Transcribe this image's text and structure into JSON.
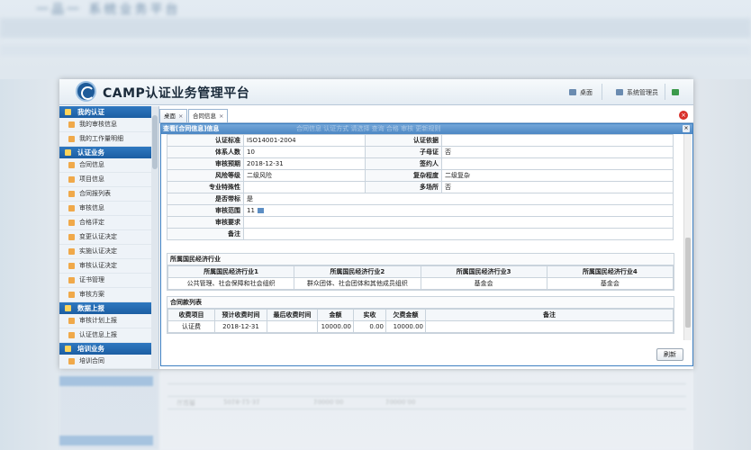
{
  "app": {
    "title": "CAMP认证业务管理平台"
  },
  "header": {
    "desktop_label": "桌面",
    "user_label": "系统管理员"
  },
  "sidebar": {
    "sections": [
      {
        "title": "我的认证",
        "items": [
          "我的审核信息",
          "我的工作量明细"
        ]
      },
      {
        "title": "认证业务",
        "items": [
          "合同信息",
          "项目信息",
          "合同报列表",
          "审核信息",
          "合格评定",
          "变更认证决定",
          "实施认证决定",
          "审核认证决定",
          "证书管理",
          "审核方案"
        ]
      },
      {
        "title": "数据上报",
        "items": [
          "审核计划上报",
          "认证信息上报"
        ]
      },
      {
        "title": "培训业务",
        "items": [
          "培训合同"
        ]
      }
    ]
  },
  "tabs": [
    {
      "label": "桌面"
    },
    {
      "label": "合同信息"
    }
  ],
  "dialog": {
    "title": "查看[合同信息]信息",
    "ghost_title": "合同信息    认证方式    请选择    查询    合格    审核    更新规则"
  },
  "form": {
    "rows": [
      {
        "l1": "认证标准",
        "v1": "ISO14001-2004",
        "l2": "认证依据",
        "v2": ""
      },
      {
        "l1": "体系人数",
        "v1": "10",
        "l2": "子母证",
        "v2": "否"
      },
      {
        "l1": "审核预期",
        "v1": "2018-12-31",
        "l2": "签约人",
        "v2": ""
      },
      {
        "l1": "风险等级",
        "v1": "二级风险",
        "l2": "复杂程度",
        "v2": "二级复杂"
      },
      {
        "l1": "专业特殊性",
        "v1": "",
        "l2": "多场所",
        "v2": "否"
      }
    ],
    "single_rows": [
      {
        "l": "是否带标",
        "v": "是"
      },
      {
        "l": "审核范围",
        "v": "11"
      },
      {
        "l": "审核要求",
        "v": ""
      },
      {
        "l": "备注",
        "v": ""
      }
    ]
  },
  "industry": {
    "title": "所属国民经济行业",
    "headers": [
      "所属国民经济行业1",
      "所属国民经济行业2",
      "所属国民经济行业3",
      "所属国民经济行业4"
    ],
    "values": [
      "公共管理、社会保障和社会组织",
      "群众团体、社会团体和其他成员组织",
      "基金会",
      "基金会"
    ]
  },
  "payments": {
    "title": "合同款列表",
    "headers": [
      "收费项目",
      "预计收费时间",
      "最后收费时间",
      "金额",
      "实收",
      "欠费金额",
      "备注"
    ],
    "rows": [
      [
        "认证费",
        "2018-12-31",
        "",
        "10000.00",
        "0.00",
        "10000.00",
        ""
      ]
    ]
  },
  "buttons": {
    "refresh": "刷新"
  },
  "background": {
    "blurred_title": "一品一 系统业务平台"
  },
  "colors": {
    "primary": "#1c5ea3",
    "header_bg": "#e4ecf3",
    "dialog_border": "#3d7fc1",
    "close_red": "#d9302a"
  }
}
